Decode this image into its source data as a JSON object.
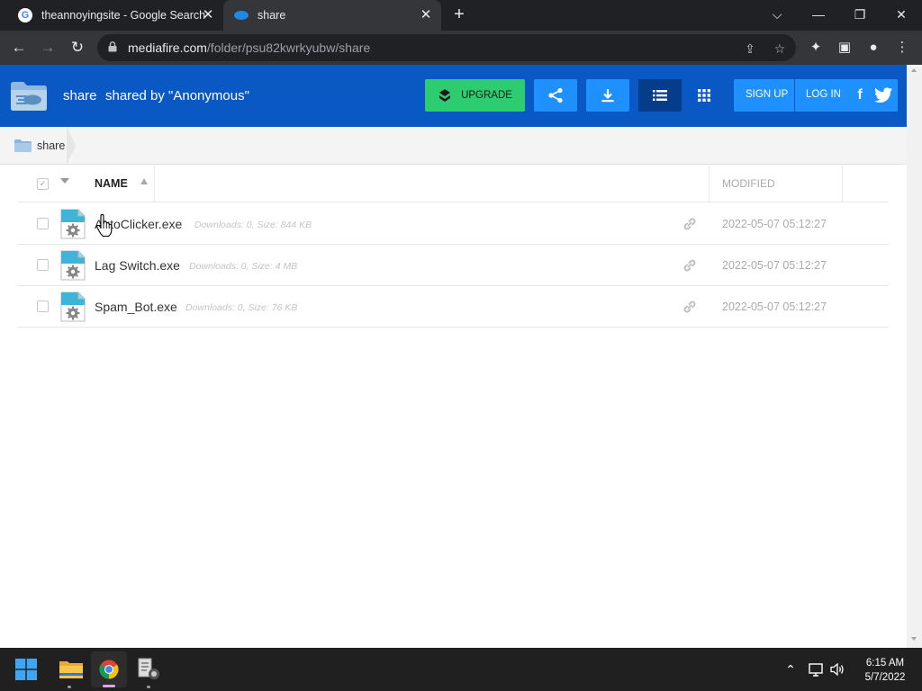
{
  "browser": {
    "tabs": [
      {
        "title": "theannoyingsite - Google Search",
        "favicon": "google-icon",
        "active": false
      },
      {
        "title": "share",
        "favicon": "mediafire-icon",
        "active": true
      }
    ],
    "url_host": "mediafire.com",
    "url_path": "/folder/psu82kwrkyubw/share"
  },
  "header": {
    "folder_name": "share",
    "shared_by": "shared by \"Anonymous\"",
    "upgrade_label": "UPGRADE",
    "signup_label": "SIGN UP",
    "login_label": "LOG IN",
    "facebook_glyph": "f"
  },
  "breadcrumb": {
    "label": "share"
  },
  "table": {
    "name_header": "NAME",
    "modified_header": "MODIFIED",
    "rows": [
      {
        "name": "AutoClicker.exe",
        "meta": "Downloads: 0, Size: 844 KB",
        "modified": "2022-05-07 05:12:27"
      },
      {
        "name": "Lag Switch.exe",
        "meta": "Downloads: 0, Size: 4 MB",
        "modified": "2022-05-07 05:12:27"
      },
      {
        "name": "Spam_Bot.exe",
        "meta": "Downloads: 0, Size: 76 KB",
        "modified": "2022-05-07 05:12:27"
      }
    ]
  },
  "taskbar": {
    "time": "6:15 AM",
    "date": "5/7/2022"
  },
  "colors": {
    "mf_header": "#0a58c3",
    "upgrade_green": "#2ecc71",
    "button_blue": "#1e90ff",
    "active_view": "#053d8a"
  }
}
